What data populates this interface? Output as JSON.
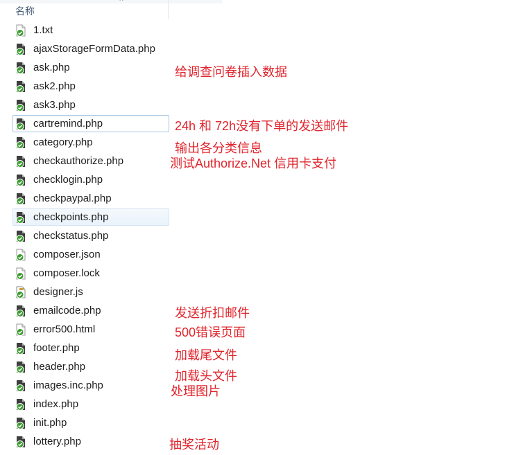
{
  "header": {
    "name_column": "名称"
  },
  "files": [
    {
      "name": "1.txt",
      "icon": "text-file-icon",
      "state": ""
    },
    {
      "name": "ajaxStorageFormData.php",
      "icon": "php-file-icon",
      "state": ""
    },
    {
      "name": "ask.php",
      "icon": "php-file-icon",
      "state": ""
    },
    {
      "name": "ask2.php",
      "icon": "php-file-icon",
      "state": ""
    },
    {
      "name": "ask3.php",
      "icon": "php-file-icon",
      "state": ""
    },
    {
      "name": "cartremind.php",
      "icon": "php-file-icon",
      "state": "selected"
    },
    {
      "name": "category.php",
      "icon": "php-file-icon",
      "state": ""
    },
    {
      "name": "checkauthorize.php",
      "icon": "php-file-icon",
      "state": ""
    },
    {
      "name": "checklogin.php",
      "icon": "php-file-icon",
      "state": ""
    },
    {
      "name": "checkpaypal.php",
      "icon": "php-file-icon",
      "state": ""
    },
    {
      "name": "checkpoints.php",
      "icon": "php-file-icon",
      "state": "hover"
    },
    {
      "name": "checkstatus.php",
      "icon": "php-file-icon",
      "state": ""
    },
    {
      "name": "composer.json",
      "icon": "text-file-icon",
      "state": ""
    },
    {
      "name": "composer.lock",
      "icon": "text-file-icon",
      "state": ""
    },
    {
      "name": "designer.js",
      "icon": "js-file-icon",
      "state": ""
    },
    {
      "name": "emailcode.php",
      "icon": "php-file-icon",
      "state": ""
    },
    {
      "name": "error500.html",
      "icon": "text-file-icon",
      "state": ""
    },
    {
      "name": "footer.php",
      "icon": "php-file-icon",
      "state": ""
    },
    {
      "name": "header.php",
      "icon": "php-file-icon",
      "state": ""
    },
    {
      "name": "images.inc.php",
      "icon": "php-file-icon",
      "state": ""
    },
    {
      "name": "index.php",
      "icon": "php-file-icon",
      "state": ""
    },
    {
      "name": "init.php",
      "icon": "php-file-icon",
      "state": ""
    },
    {
      "name": "lottery.php",
      "icon": "php-file-icon",
      "state": ""
    }
  ],
  "annotations": [
    {
      "text": "给调查问卷插入数据"
    },
    {
      "text": "24h 和 72h没有下单的发送邮件"
    },
    {
      "text": "输出各分类信息"
    },
    {
      "text": "测试Authorize.Net 信用卡支付"
    },
    {
      "text": "发送折扣邮件"
    },
    {
      "text": "500错误页面"
    },
    {
      "text": "加载尾文件"
    },
    {
      "text": "加载头文件"
    },
    {
      "text": "处理图片"
    },
    {
      "text": "抽奖活动"
    }
  ],
  "colors": {
    "annotation": "#e0242c",
    "icon_green": "#3a9c2e",
    "selection_border": "#a6c3e2"
  }
}
